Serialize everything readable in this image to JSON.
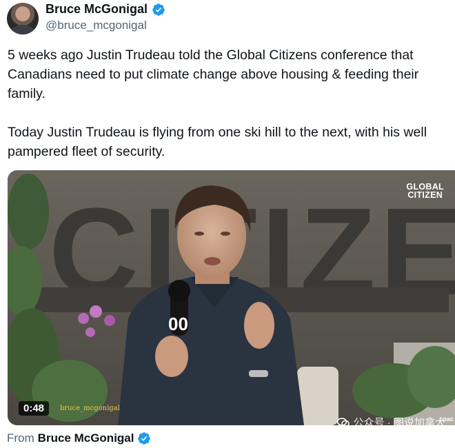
{
  "author": {
    "name": "Bruce McGonigal",
    "handle": "@bruce_mcgonigal",
    "verified_icon": "verified-badge-icon",
    "verified_color": "#1d9bf0"
  },
  "tweet": {
    "paragraphs": [
      "5 weeks ago Justin Trudeau told the Global Citizens conference that Canadians need to put climate change above housing & feeding their family.",
      "Today Justin Trudeau is flying from one ski hill to the next, with his well pampered fleet of security."
    ]
  },
  "media": {
    "duration": "0:48",
    "overlay_handle": "bruce_mcgonigal",
    "logo_line1": "GLOBAL",
    "logo_line2": "CITIZEN",
    "backdrop_letters": "CITIZEN",
    "mic_label": "00",
    "broadcaster": "cpac",
    "platform_watermark": "公众号 · 图说加拿大",
    "platform_icon": "chat-bubbles-icon"
  },
  "footer": {
    "from_label": "From",
    "from_name": "Bruce McGonigal"
  }
}
